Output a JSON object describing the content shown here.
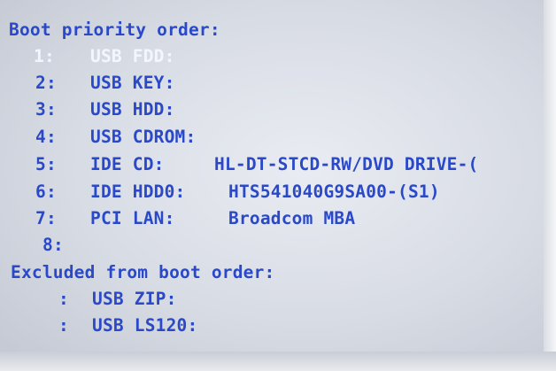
{
  "boot_menu": {
    "heading": "Boot priority order:",
    "items": [
      {
        "index": "1:",
        "device": "USB FDD:",
        "description": "",
        "selected": true
      },
      {
        "index": "2:",
        "device": "USB KEY:",
        "description": ""
      },
      {
        "index": "3:",
        "device": "USB HDD:",
        "description": ""
      },
      {
        "index": "4:",
        "device": "USB CDROM:",
        "description": ""
      },
      {
        "index": "5:",
        "device": "IDE CD:",
        "description": "HL-DT-STCD-RW/DVD DRIVE-("
      },
      {
        "index": "6:",
        "device": "IDE HDD0:",
        "description": "HTS541040G9SA00-(S1)"
      },
      {
        "index": "7:",
        "device": "PCI LAN:",
        "description": "Broadcom MBA"
      },
      {
        "index": "8:",
        "device": "",
        "description": ""
      }
    ],
    "excluded_heading": "Excluded from boot order:",
    "excluded_items": [
      {
        "index": ":",
        "device": "USB ZIP:"
      },
      {
        "index": ":",
        "device": "USB LS120:"
      }
    ]
  },
  "colors": {
    "text": "#2a49c9",
    "selected_text": "#f4f6ff",
    "background": "#dde1e8"
  }
}
